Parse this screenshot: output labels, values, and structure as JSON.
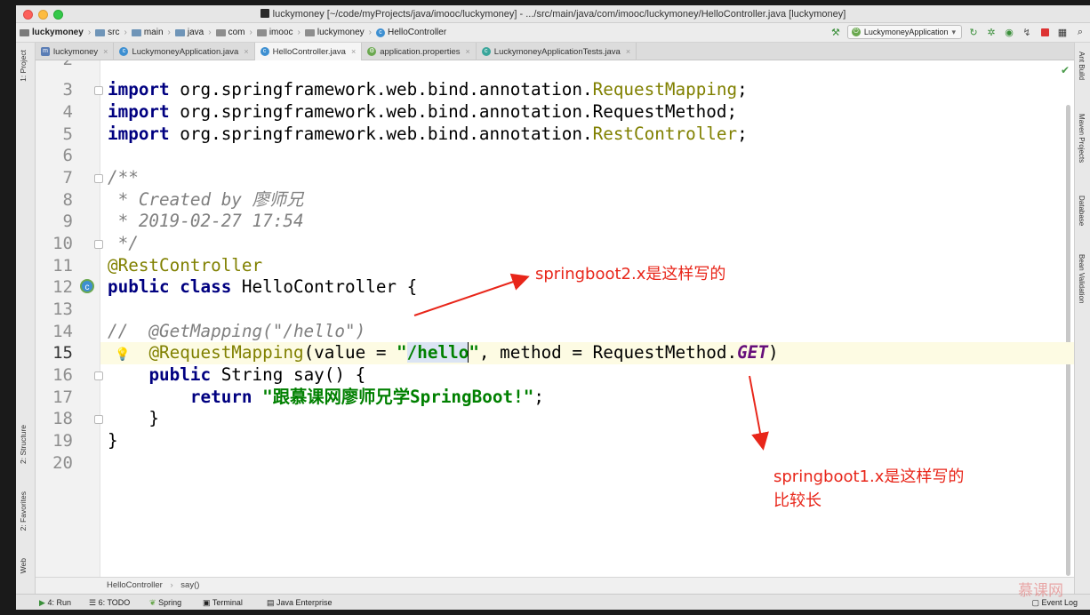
{
  "window": {
    "title": "luckymoney [~/code/myProjects/java/imooc/luckymoney] - .../src/main/java/com/imooc/luckymoney/HelloController.java [luckymoney]"
  },
  "nav": {
    "crumbs": [
      "luckymoney",
      "src",
      "main",
      "java",
      "com",
      "imooc",
      "luckymoney",
      "HelloController"
    ],
    "run_config": "LuckymoneyApplication"
  },
  "tabs": [
    {
      "label": "luckymoney",
      "icon": "module-icon"
    },
    {
      "label": "LuckymoneyApplication.java",
      "icon": "spring-class-icon"
    },
    {
      "label": "HelloController.java",
      "icon": "class-icon"
    },
    {
      "label": "application.properties",
      "icon": "properties-icon"
    },
    {
      "label": "LuckymoneyApplicationTests.java",
      "icon": "test-class-icon"
    }
  ],
  "left_tools": [
    "1: Project",
    "2: Structure",
    "2: Favorites",
    "Web"
  ],
  "right_tools": [
    "Ant Build",
    "Maven Projects",
    "Database",
    "Bean Validation"
  ],
  "editor": {
    "line_numbers": [
      "2",
      "3",
      "4",
      "5",
      "6",
      "7",
      "8",
      "9",
      "10",
      "11",
      "12",
      "13",
      "14",
      "15",
      "16",
      "17",
      "18",
      "19",
      "20"
    ],
    "breadcrumb": [
      "HelloController",
      "say()"
    ],
    "code": {
      "l3_kw": "import",
      "l3_pkg": " org.springframework.web.bind.annotation.",
      "l3_cls": "RequestMapping",
      "l3_end": ";",
      "l4_kw": "import",
      "l4_pkg": " org.springframework.web.bind.annotation.RequestMethod;",
      "l5_kw": "import",
      "l5_pkg": " org.springframework.web.bind.annotation.",
      "l5_cls": "RestController",
      "l5_end": ";",
      "l7": "/**",
      "l8": " * Created by 廖师兄",
      "l9": " * 2019-02-27 17:54",
      "l10": " */",
      "l11": "@RestController",
      "l12_kw": "public class",
      "l12_rest": " HelloController {",
      "l14": "//  @GetMapping(\"/hello\")",
      "l15_indent": "    ",
      "l15_ann": "@RequestMapping",
      "l15_a": "(value = ",
      "l15_q1": "\"",
      "l15_hl": "/hello",
      "l15_q2": "\"",
      "l15_b": ", method = RequestMethod.",
      "l15_get": "GET",
      "l15_c": ")",
      "l16_indent": "    ",
      "l16_kw": "public",
      "l16_rest": " String say() {",
      "l17_indent": "        ",
      "l17_kw": "return",
      "l17_sp": " ",
      "l17_str": "\"跟慕课网廖师兄学SpringBoot!\"",
      "l17_end": ";",
      "l18": "    }",
      "l19": "}"
    }
  },
  "bottom_tools": [
    {
      "label": "4: Run"
    },
    {
      "label": "6: TODO"
    },
    {
      "label": "Spring"
    },
    {
      "label": "Terminal"
    },
    {
      "label": "Java Enterprise"
    }
  ],
  "event_log": "Event Log",
  "annotations": {
    "note1": "springboot2.x是这样写的",
    "note2_line1": "springboot1.x是这样写的",
    "note2_line2": "比较长"
  },
  "watermark": "慕课网",
  "colors": {
    "annotation_red": "#e8261a",
    "keyword": "#000080",
    "annotation": "#808000",
    "string": "#008000",
    "comment": "#808080"
  }
}
